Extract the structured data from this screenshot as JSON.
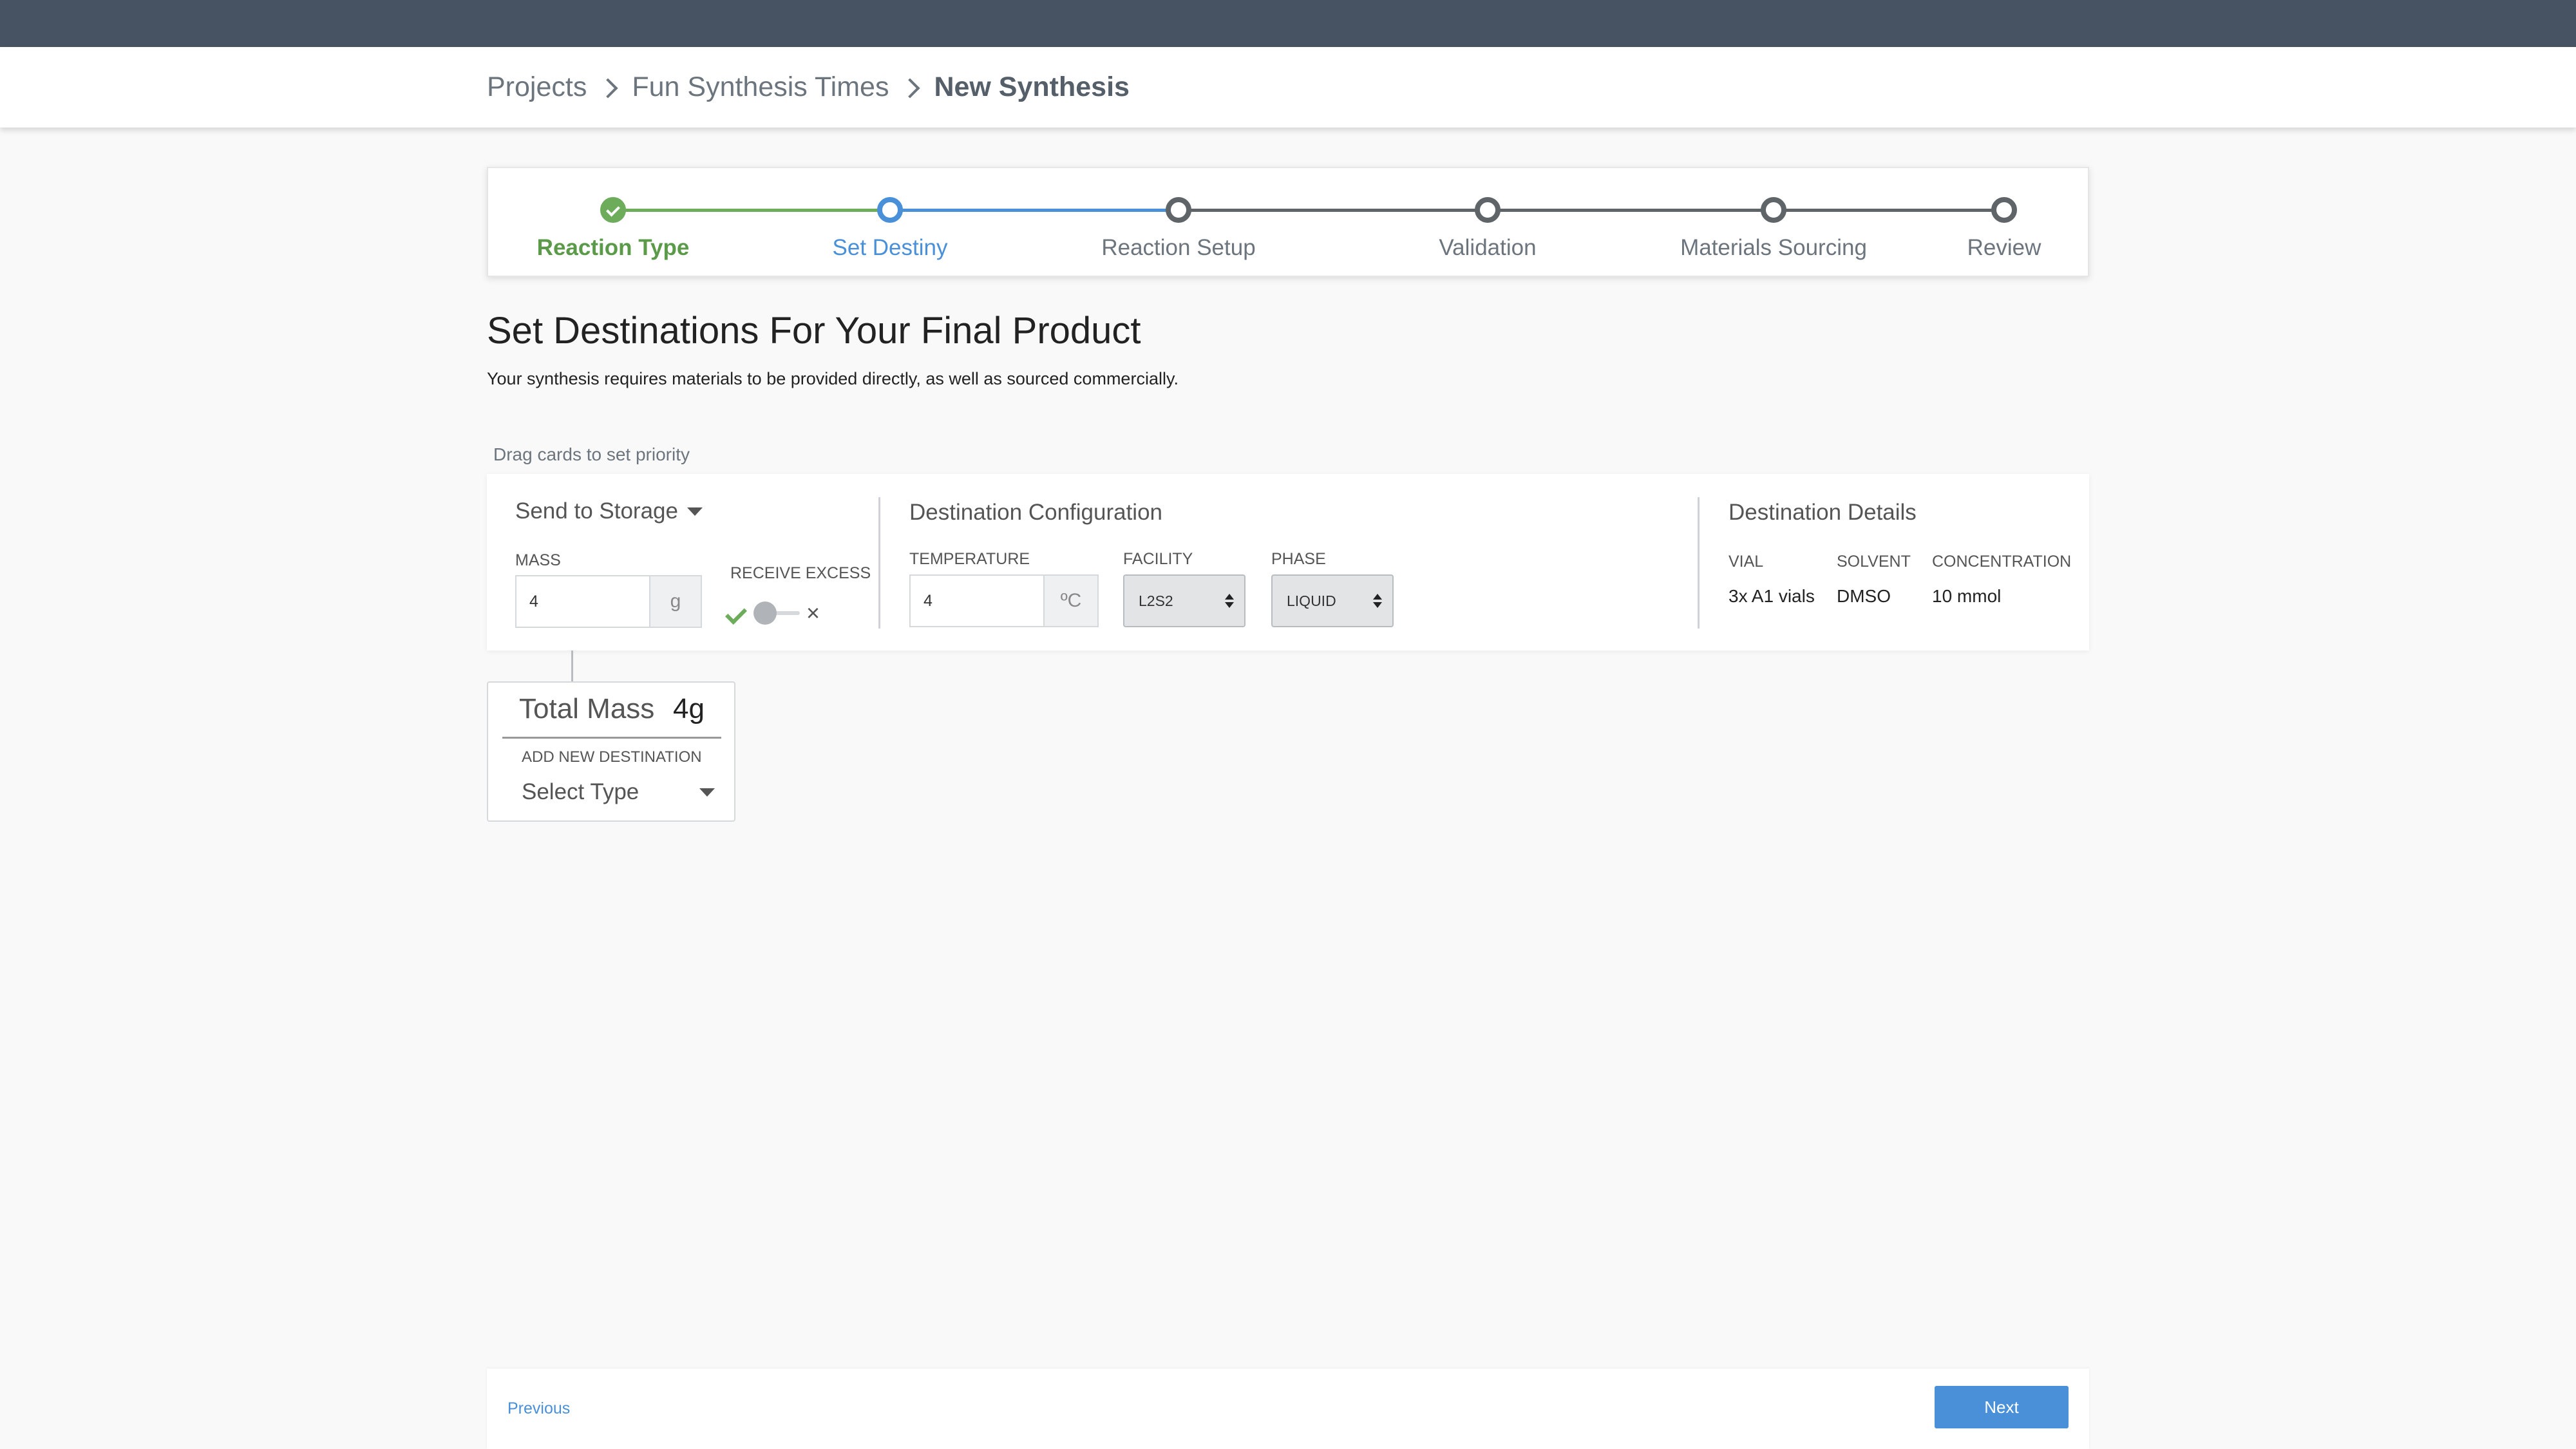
{
  "breadcrumb": {
    "items": [
      "Projects",
      "Fun Synthesis Times"
    ],
    "current": "New Synthesis"
  },
  "stepper": {
    "steps": [
      {
        "label": "Reaction Type",
        "state": "done"
      },
      {
        "label": "Set Destiny",
        "state": "active"
      },
      {
        "label": "Reaction Setup",
        "state": "pending"
      },
      {
        "label": "Validation",
        "state": "pending"
      },
      {
        "label": "Materials Sourcing",
        "state": "pending"
      },
      {
        "label": "Review",
        "state": "pending"
      }
    ]
  },
  "page": {
    "title": "Set Destinations For Your Final Product",
    "subtitle": "Your synthesis requires materials to be provided directly, as well as sourced commercially.",
    "drag_hint": "Drag cards to set priority"
  },
  "destination_card": {
    "send_select": "Send to Storage",
    "mass_label": "MASS",
    "mass_value": "4",
    "mass_unit": "g",
    "receive_excess_label": "RECEIVE EXCESS",
    "config_heading": "Destination Configuration",
    "temperature_label": "TEMPERATURE",
    "temperature_value": "4",
    "temperature_unit": "ºC",
    "facility_label": "FACILITY",
    "facility_value": "L2S2",
    "phase_label": "PHASE",
    "phase_value": "LIQUID",
    "details_heading": "Destination Details",
    "details": {
      "vial_label": "VIAL",
      "vial_value": "3x A1 vials",
      "solvent_label": "SOLVENT",
      "solvent_value": "DMSO",
      "concentration_label": "CONCENTRATION",
      "concentration_value": "10 mmol"
    }
  },
  "total_card": {
    "label": "Total Mass",
    "value": "4g",
    "add_label": "ADD NEW DESTINATION",
    "select_type": "Select Type"
  },
  "footer": {
    "previous": "Previous",
    "next": "Next"
  },
  "colors": {
    "topbar": "#475263",
    "accent": "#4a90d9",
    "success": "#6cac5a"
  }
}
